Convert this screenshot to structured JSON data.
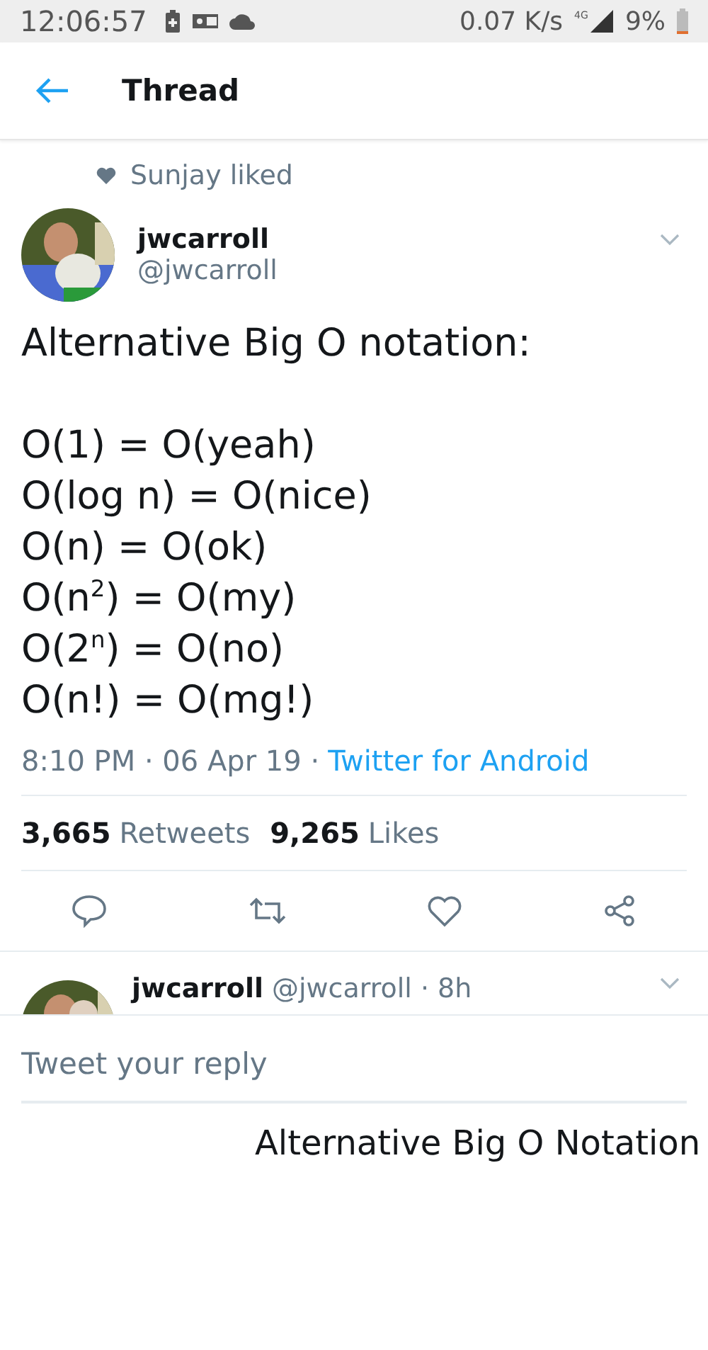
{
  "status_bar": {
    "time": "12:06:57",
    "speed": "0.07 K/s",
    "network": "4G",
    "battery": "9%"
  },
  "header": {
    "title": "Thread"
  },
  "social_context": {
    "text": "Sunjay liked"
  },
  "tweet": {
    "name": "jwcarroll",
    "handle": "@jwcarroll",
    "intro": "Alternative Big O notation:",
    "lines": [
      "O(1) = O(yeah)",
      "O(log n) = O(nice)",
      "O(n) = O(ok)",
      "O(n$^{2}$) = O(my)",
      "O(2$^{n}$) = O(no)",
      "O(n!) = O(mg!)"
    ],
    "timestamp": "8:10 PM · 06 Apr 19 ·",
    "source": "Twitter for Android",
    "retweets": "3,665",
    "retweets_label": "Retweets",
    "likes": "9,265",
    "likes_label": "Likes"
  },
  "reply": {
    "name": "jwcarroll",
    "handle": "@jwcarroll · 8h"
  },
  "composer": {
    "placeholder": "Tweet your reply"
  },
  "caption": "Alternative Big O Notation"
}
